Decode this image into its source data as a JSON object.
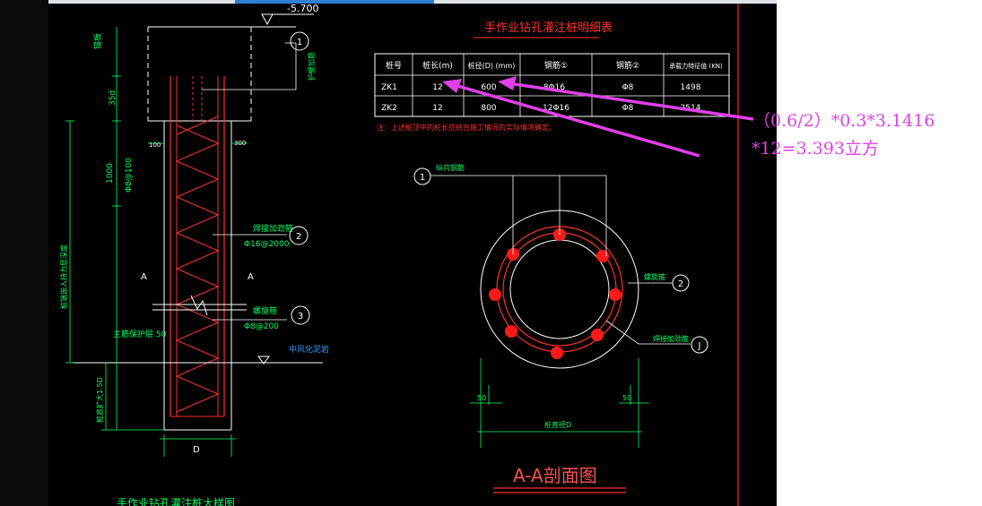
{
  "top_bar": {
    "color_active": "#2f7fd6",
    "color_bg": "#dfe3e8"
  },
  "elevation": {
    "top": "-5.700"
  },
  "left_labels": {
    "anchor": "锚板",
    "cage_label": "护壁加筋",
    "height_35d": "35d",
    "height_1000": "1000",
    "spacing_phi8": "Φ8@100",
    "dim_100": "100",
    "dim_300": "300",
    "vertical_note": "桩端嵌入持力层深度",
    "section_a_left": "A",
    "section_a_right": "A",
    "bottom_note": "桩底扩大1.5D",
    "cover": "主筋保护层 50",
    "bottom_d": "D",
    "bottom_title": "手作业钻孔灌注桩大样图",
    "cement": "中风化泥岩",
    "weld_hoop": "焊接加劲箍",
    "weld_hoop_spacing": "Φ16@2000",
    "spiral": "螺旋箍",
    "spiral_spacing": "Φ8@200"
  },
  "callouts": {
    "c1": "1",
    "c2": "2",
    "c3": "3",
    "c4": "2",
    "c5": "1",
    "c6": "J"
  },
  "table": {
    "title": "手作业钻孔灌注桩明细表",
    "headers": [
      "桩号",
      "桩长(m)",
      "桩径(D) (mm)",
      "钢筋①",
      "钢筋②",
      "承载力特征值 (KN)"
    ],
    "rows": [
      [
        "ZK1",
        "12",
        "600",
        "8Φ16",
        "Φ8",
        "1498"
      ],
      [
        "ZK2",
        "12",
        "800",
        "12Φ16",
        "Φ8",
        "2514"
      ]
    ],
    "note": "注：上述桩顶中的桩长应结合施工情况的实际情况确定。"
  },
  "annotation": {
    "line1": "（0.6/2）*0.3*3.1416",
    "line2": "*12=3.393立方",
    "color": "#e040e8"
  },
  "section": {
    "label_top": "纵向钢筋",
    "label_spiral": "螺旋箍",
    "label_weld": "焊接加劲箍",
    "dim_left": "50",
    "dim_right": "50",
    "dim_diameter": "桩直径D",
    "title": "A-A剖面图"
  }
}
